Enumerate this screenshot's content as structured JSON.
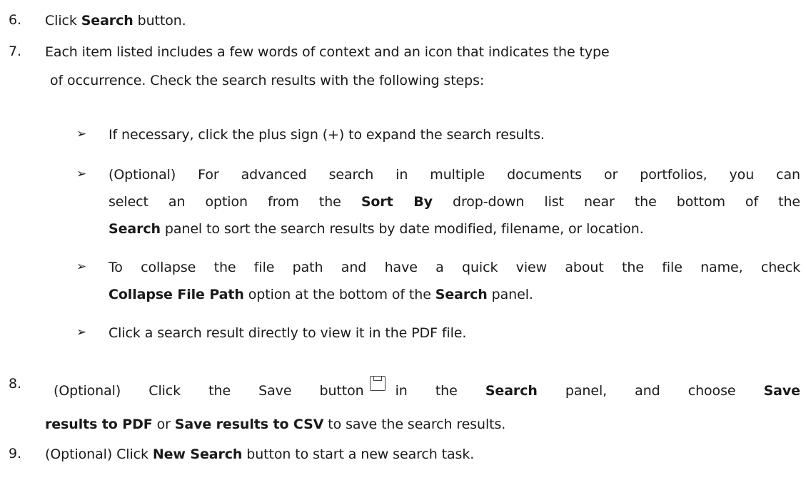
{
  "steps": {
    "s6": {
      "num": "6.",
      "pre": "Click ",
      "b1": "Search",
      "post": " button."
    },
    "s7": {
      "num": "7.",
      "line1": "Each item listed includes a few words of context and an icon that indicates the type",
      "line2": "of occurrence. Check the search results with the following steps:"
    },
    "bullets": {
      "arrow": "➢",
      "b1": "If necessary, click the plus sign (+) to expand the search results.",
      "b2": {
        "l1": "(Optional) For advanced search in multiple documents or portfolios, you can",
        "l2a": "select an option from the ",
        "l2b": "Sort By",
        "l2c": " drop-down list near the bottom of the",
        "l3a": "Search",
        "l3b": " panel to sort the search results by date modified, filename, or location."
      },
      "b3": {
        "l1": "To collapse the file path and have a quick view about the file name, check",
        "l2a": "Collapse File Path",
        "l2b": " option at the bottom of the ",
        "l2c": "Search",
        "l2d": " panel."
      },
      "b4": "Click a search result directly to view it in the PDF file."
    },
    "s8": {
      "num": "8.",
      "l1a": "(Optional) Click the Save button",
      "save_icon": "save-icon",
      "l1b": "in the ",
      "l1c": "Search",
      "l1d": " panel, and choose ",
      "l1e": "Save",
      "l2a": "results to PDF",
      "l2b": " or ",
      "l2c": "Save results to CSV",
      "l2d": " to save the search results."
    },
    "s9": {
      "num": "9.",
      "pre": "(Optional) Click ",
      "b1": "New Search",
      "post": " button to start a new search task."
    }
  }
}
